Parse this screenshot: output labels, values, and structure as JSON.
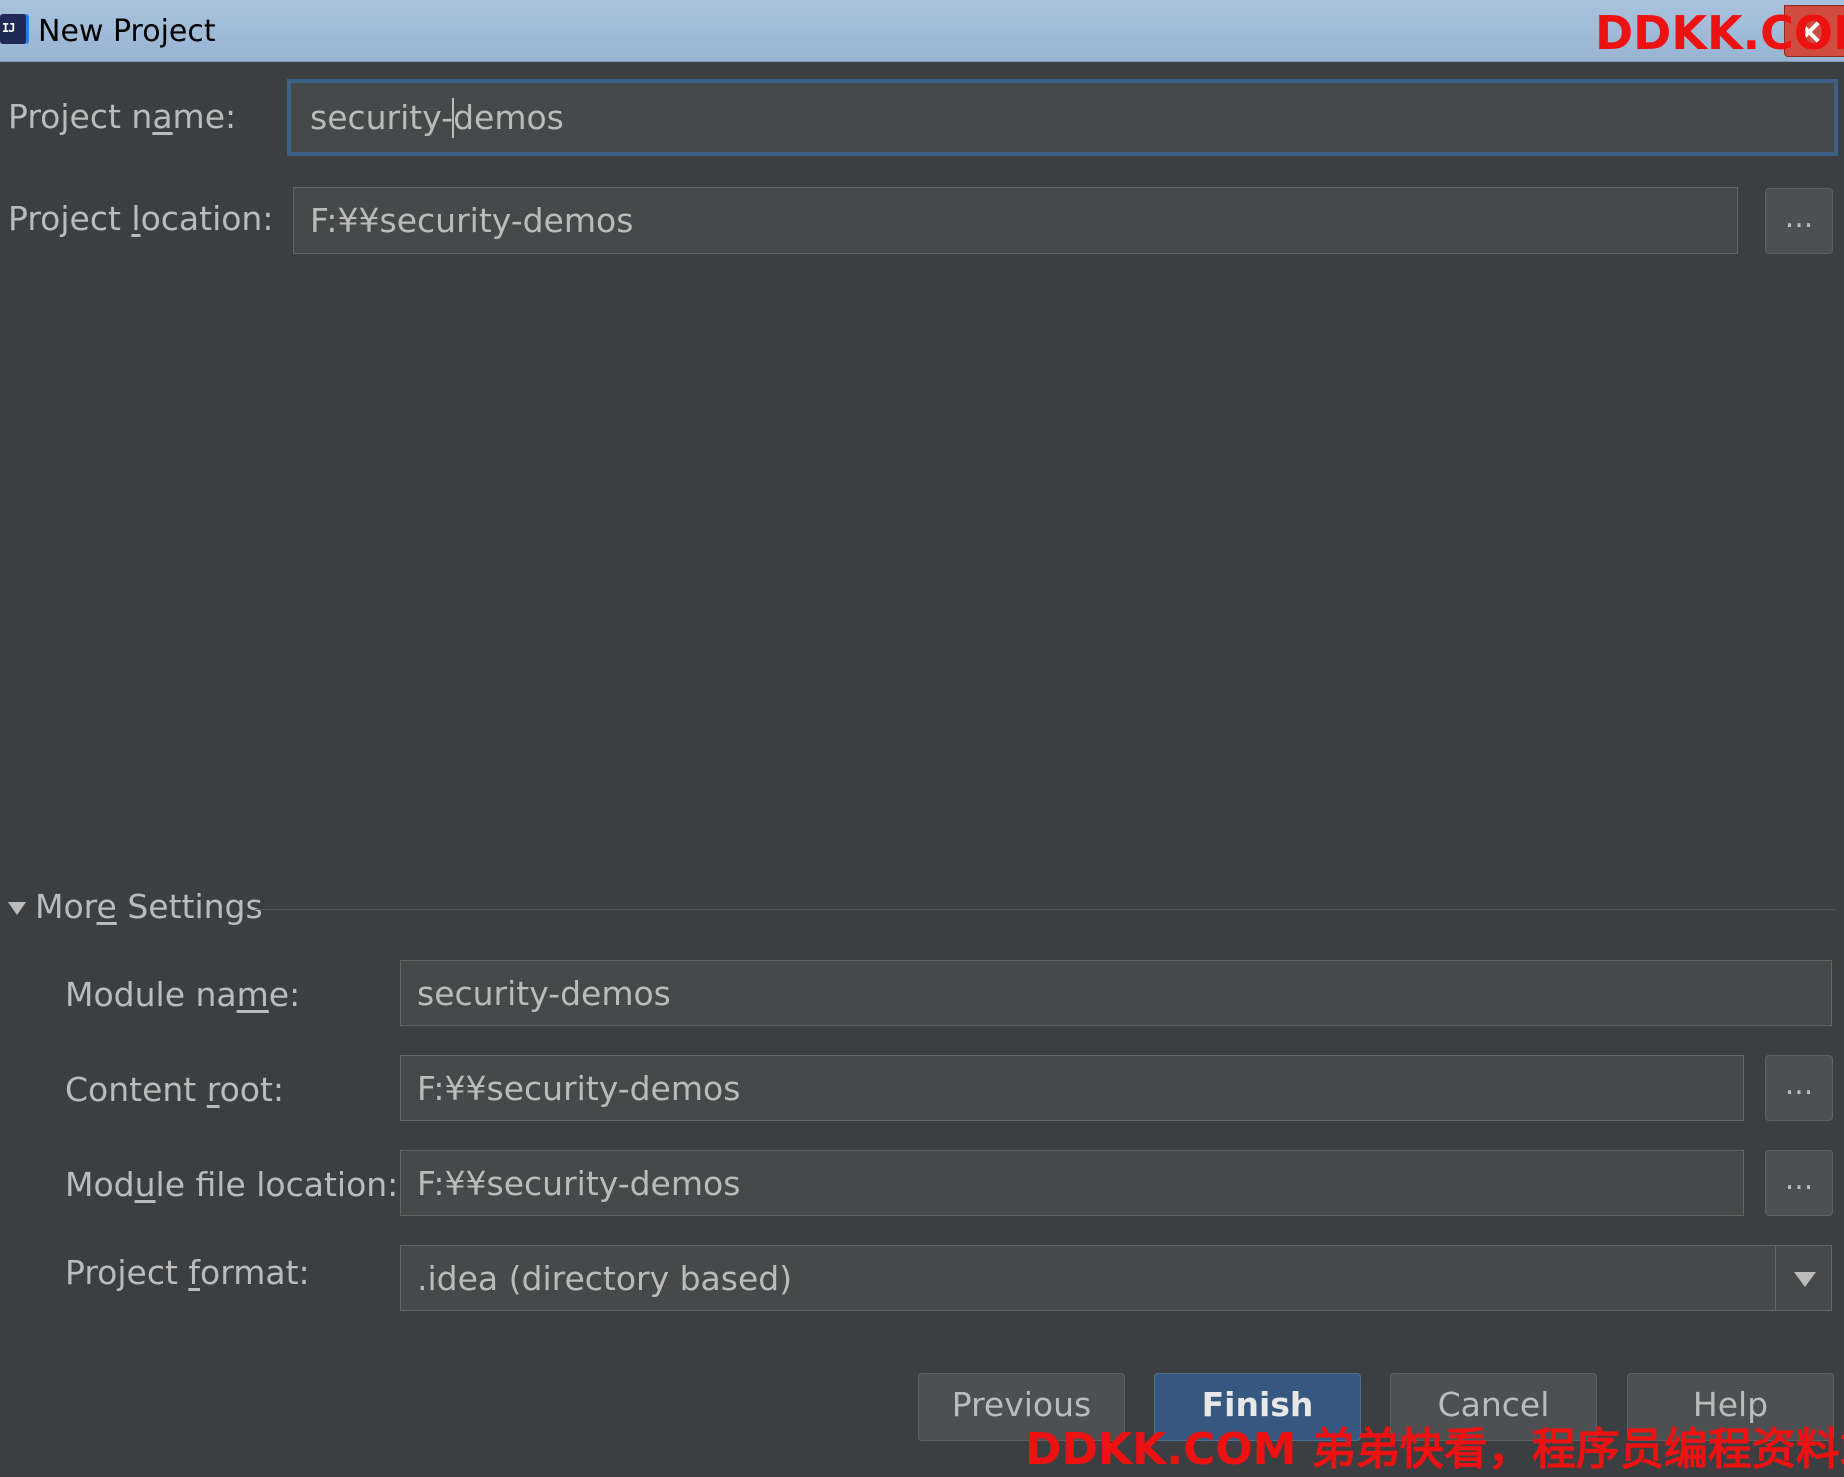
{
  "window": {
    "title": "New Project"
  },
  "watermarks": {
    "top": "DDKK.COM",
    "bottom": "DDKK.COM 弟弟快看，程序员编程资料站"
  },
  "project": {
    "name_label": "Project name:",
    "name_value_before_caret": "security-",
    "name_value_after_caret": "demos",
    "location_label": "Project location:",
    "location_value": "F:¥¥security-demos",
    "browse_label": "..."
  },
  "more_settings": {
    "title": "More Settings",
    "module_name_label": "Module name:",
    "module_name_value": "security-demos",
    "content_root_label": "Content root:",
    "content_root_value": "F:¥¥security-demos",
    "module_file_location_label": "Module file location:",
    "module_file_location_value": "F:¥¥security-demos",
    "project_format_label": "Project format:",
    "project_format_value": ".idea (directory based)",
    "browse_label": "..."
  },
  "buttons": {
    "previous": "Previous",
    "finish": "Finish",
    "cancel": "Cancel",
    "help": "Help"
  }
}
